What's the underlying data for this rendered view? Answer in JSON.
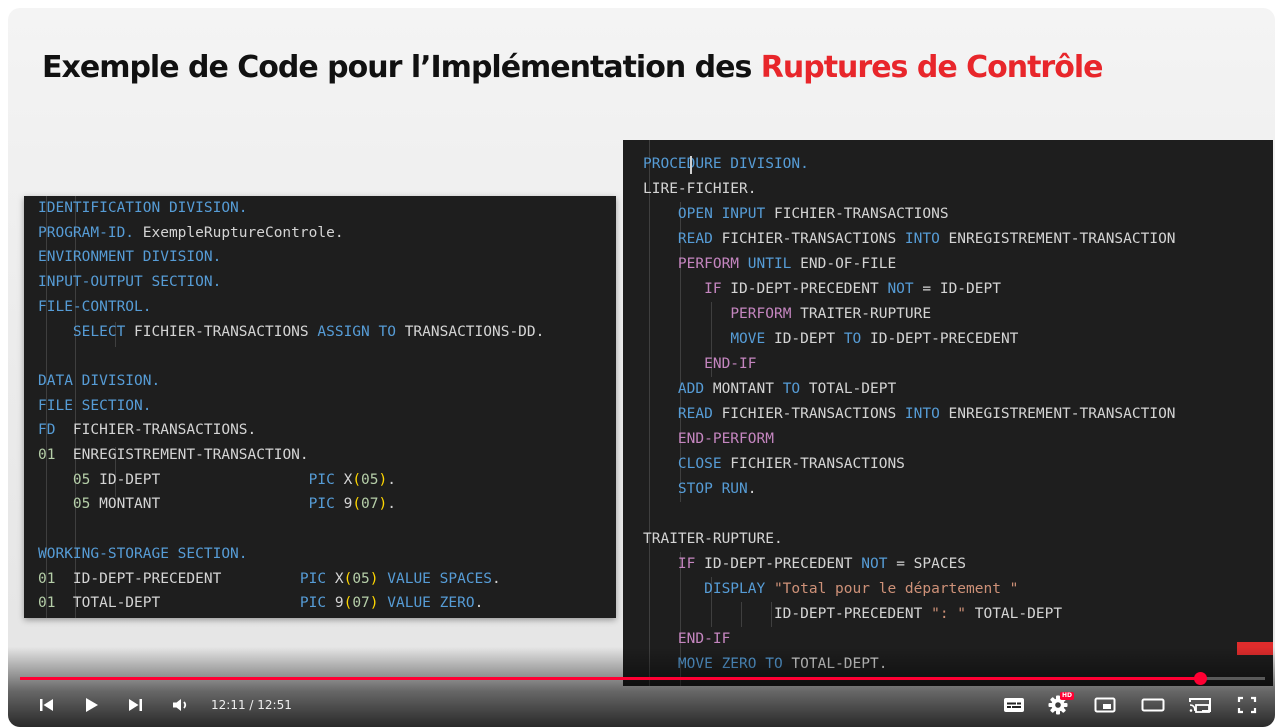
{
  "slide": {
    "title_prefix": "Exemple de Code pour l’Implémentation des ",
    "title_accent": "Ruptures de Contrôle",
    "accent_color": "#e8262b"
  },
  "code_left": {
    "lines": [
      [
        [
          "IDENTIFICATION DIVISION.",
          "kw"
        ]
      ],
      [
        [
          "PROGRAM-ID.",
          "kw"
        ],
        [
          " ExempleRuptureControle.",
          ""
        ]
      ],
      [
        [
          "ENVIRONMENT DIVISION.",
          "kw"
        ]
      ],
      [
        [
          "INPUT-OUTPUT SECTION.",
          "kw"
        ]
      ],
      [
        [
          "FILE-CONTROL.",
          "kw"
        ]
      ],
      [
        [
          "    ",
          ""
        ],
        [
          "SELECT",
          "kw"
        ],
        [
          " FICHIER-TRANSACTIONS ",
          ""
        ],
        [
          "ASSIGN",
          "kw"
        ],
        [
          " ",
          ""
        ],
        [
          "TO",
          "kw"
        ],
        [
          " TRANSACTIONS-DD.",
          ""
        ]
      ],
      [],
      [
        [
          "DATA DIVISION.",
          "kw"
        ]
      ],
      [
        [
          "FILE SECTION.",
          "kw"
        ]
      ],
      [
        [
          "FD",
          "kw"
        ],
        [
          "  FICHIER-TRANSACTIONS.",
          ""
        ]
      ],
      [
        [
          "01",
          "num"
        ],
        [
          "  ENREGISTREMENT-TRANSACTION.",
          ""
        ]
      ],
      [
        [
          "    ",
          ""
        ],
        [
          "05",
          "num"
        ],
        [
          " ID-DEPT                 ",
          ""
        ],
        [
          "PIC",
          "kw"
        ],
        [
          " X",
          ""
        ],
        [
          "(",
          "br"
        ],
        [
          "05",
          "num"
        ],
        [
          ")",
          "br"
        ],
        [
          ".",
          ""
        ]
      ],
      [
        [
          "    ",
          ""
        ],
        [
          "05",
          "num"
        ],
        [
          " MONTANT                 ",
          ""
        ],
        [
          "PIC",
          "kw"
        ],
        [
          " 9",
          ""
        ],
        [
          "(",
          "br"
        ],
        [
          "07",
          "num"
        ],
        [
          ")",
          "br"
        ],
        [
          ".",
          ""
        ]
      ],
      [],
      [
        [
          "WORKING-STORAGE SECTION.",
          "kw"
        ]
      ],
      [
        [
          "01",
          "num"
        ],
        [
          "  ID-DEPT-PRECEDENT         ",
          ""
        ],
        [
          "PIC",
          "kw"
        ],
        [
          " X",
          ""
        ],
        [
          "(",
          "br"
        ],
        [
          "05",
          "num"
        ],
        [
          ")",
          "br"
        ],
        [
          " ",
          ""
        ],
        [
          "VALUE",
          "kw"
        ],
        [
          " ",
          ""
        ],
        [
          "SPACES",
          "kw"
        ],
        [
          ".",
          ""
        ]
      ],
      [
        [
          "01",
          "num"
        ],
        [
          "  TOTAL-DEPT                ",
          ""
        ],
        [
          "PIC",
          "kw"
        ],
        [
          " 9",
          ""
        ],
        [
          "(",
          "br"
        ],
        [
          "07",
          "num"
        ],
        [
          ")",
          "br"
        ],
        [
          " ",
          ""
        ],
        [
          "VALUE",
          "kw"
        ],
        [
          " ",
          ""
        ],
        [
          "ZERO",
          "kw"
        ],
        [
          ".",
          ""
        ]
      ]
    ]
  },
  "code_right": {
    "lines": [
      [
        [
          "PROCEDURE DIVISION.",
          "kw"
        ]
      ],
      [
        [
          "LIRE-FICHIER.",
          ""
        ]
      ],
      [
        [
          "    ",
          ""
        ],
        [
          "OPEN",
          "kw"
        ],
        [
          " ",
          ""
        ],
        [
          "INPUT",
          "kw"
        ],
        [
          " FICHIER-TRANSACTIONS",
          ""
        ]
      ],
      [
        [
          "    ",
          ""
        ],
        [
          "READ",
          "kw"
        ],
        [
          " FICHIER-TRANSACTIONS ",
          ""
        ],
        [
          "INTO",
          "kw"
        ],
        [
          " ENREGISTREMENT-TRANSACTION",
          ""
        ]
      ],
      [
        [
          "    ",
          ""
        ],
        [
          "PERFORM",
          "fn"
        ],
        [
          " ",
          ""
        ],
        [
          "UNTIL",
          "kw"
        ],
        [
          " END-OF-FILE",
          ""
        ]
      ],
      [
        [
          "       ",
          ""
        ],
        [
          "IF",
          "fn"
        ],
        [
          " ID-DEPT-PRECEDENT ",
          ""
        ],
        [
          "NOT",
          "kw"
        ],
        [
          " = ID-DEPT",
          ""
        ]
      ],
      [
        [
          "          ",
          ""
        ],
        [
          "PERFORM",
          "fn"
        ],
        [
          " TRAITER-RUPTURE",
          ""
        ]
      ],
      [
        [
          "          ",
          ""
        ],
        [
          "MOVE",
          "kw"
        ],
        [
          " ID-DEPT ",
          ""
        ],
        [
          "TO",
          "kw"
        ],
        [
          " ID-DEPT-PRECEDENT",
          ""
        ]
      ],
      [
        [
          "       ",
          ""
        ],
        [
          "END-IF",
          "fn"
        ]
      ],
      [
        [
          "    ",
          ""
        ],
        [
          "ADD",
          "kw"
        ],
        [
          " MONTANT ",
          ""
        ],
        [
          "TO",
          "kw"
        ],
        [
          " TOTAL-DEPT",
          ""
        ]
      ],
      [
        [
          "    ",
          ""
        ],
        [
          "READ",
          "kw"
        ],
        [
          " FICHIER-TRANSACTIONS ",
          ""
        ],
        [
          "INTO",
          "kw"
        ],
        [
          " ENREGISTREMENT-TRANSACTION",
          ""
        ]
      ],
      [
        [
          "    ",
          ""
        ],
        [
          "END-PERFORM",
          "fn"
        ]
      ],
      [
        [
          "    ",
          ""
        ],
        [
          "CLOSE",
          "kw"
        ],
        [
          " FICHIER-TRANSACTIONS",
          ""
        ]
      ],
      [
        [
          "    ",
          ""
        ],
        [
          "STOP RUN",
          "kw"
        ],
        [
          ".",
          ""
        ]
      ],
      [],
      [
        [
          "TRAITER-RUPTURE.",
          ""
        ]
      ],
      [
        [
          "    ",
          ""
        ],
        [
          "IF",
          "fn"
        ],
        [
          " ID-DEPT-PRECEDENT ",
          ""
        ],
        [
          "NOT",
          "kw"
        ],
        [
          " = SPACES",
          ""
        ]
      ],
      [
        [
          "       ",
          ""
        ],
        [
          "DISPLAY",
          "kw"
        ],
        [
          " ",
          ""
        ],
        [
          "\"Total pour le département \"",
          "str"
        ]
      ],
      [
        [
          "               ID-DEPT-PRECEDENT ",
          ""
        ],
        [
          "\": \"",
          "str"
        ],
        [
          " TOTAL-DEPT",
          ""
        ]
      ],
      [
        [
          "    ",
          ""
        ],
        [
          "END-IF",
          "fn"
        ]
      ],
      [
        [
          "    ",
          ""
        ],
        [
          "MOVE",
          "kw"
        ],
        [
          " ",
          ""
        ],
        [
          "ZERO",
          "kw"
        ],
        [
          " ",
          ""
        ],
        [
          "TO",
          "kw"
        ],
        [
          " TOTAL-DEPT.",
          ""
        ]
      ]
    ]
  },
  "player": {
    "time_current": "12:11",
    "time_total": "12:51",
    "time_display": "12:11 / 12:51",
    "progress": 0.948,
    "hd_badge": "HD",
    "progress_color": "#ff0033"
  },
  "icons": {
    "previous": "previous-icon",
    "play": "play-icon",
    "next": "next-icon",
    "volume": "volume-icon",
    "subtitles": "subtitles-icon",
    "settings": "gear-icon",
    "miniplayer": "miniplayer-icon",
    "theater": "theater-icon",
    "cast": "cast-icon",
    "fullscreen": "fullscreen-icon"
  }
}
